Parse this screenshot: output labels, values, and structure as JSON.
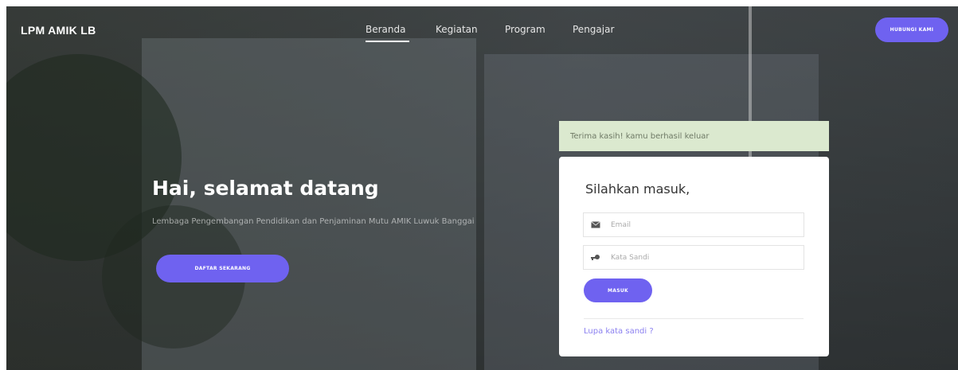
{
  "brand": {
    "name": "LPM AMIK LB"
  },
  "nav": {
    "items": [
      {
        "label": "Beranda",
        "active": true
      },
      {
        "label": "Kegiatan",
        "active": false
      },
      {
        "label": "Program",
        "active": false
      },
      {
        "label": "Pengajar",
        "active": false
      }
    ],
    "cta_label": "HUBUNGI KAMI"
  },
  "hero": {
    "title": "Hai, selamat datang",
    "subtitle": "Lembaga Pengembangan Pendidikan dan Penjaminan Mutu AMIK Luwuk Banggai",
    "cta_label": "DAFTAR SEKARANG"
  },
  "alert": {
    "message": "Terima kasih! kamu berhasil keluar"
  },
  "login": {
    "title": "Silahkan masuk,",
    "email_placeholder": "Email",
    "password_placeholder": "Kata Sandi",
    "submit_label": "MASUK",
    "forgot_label": "Lupa kata sandi ?"
  },
  "colors": {
    "accent": "#6f62f0",
    "alert_bg": "#dbe9cf",
    "link": "#8b80f0"
  },
  "icons": {
    "email": "envelope-icon",
    "password": "key-icon"
  }
}
